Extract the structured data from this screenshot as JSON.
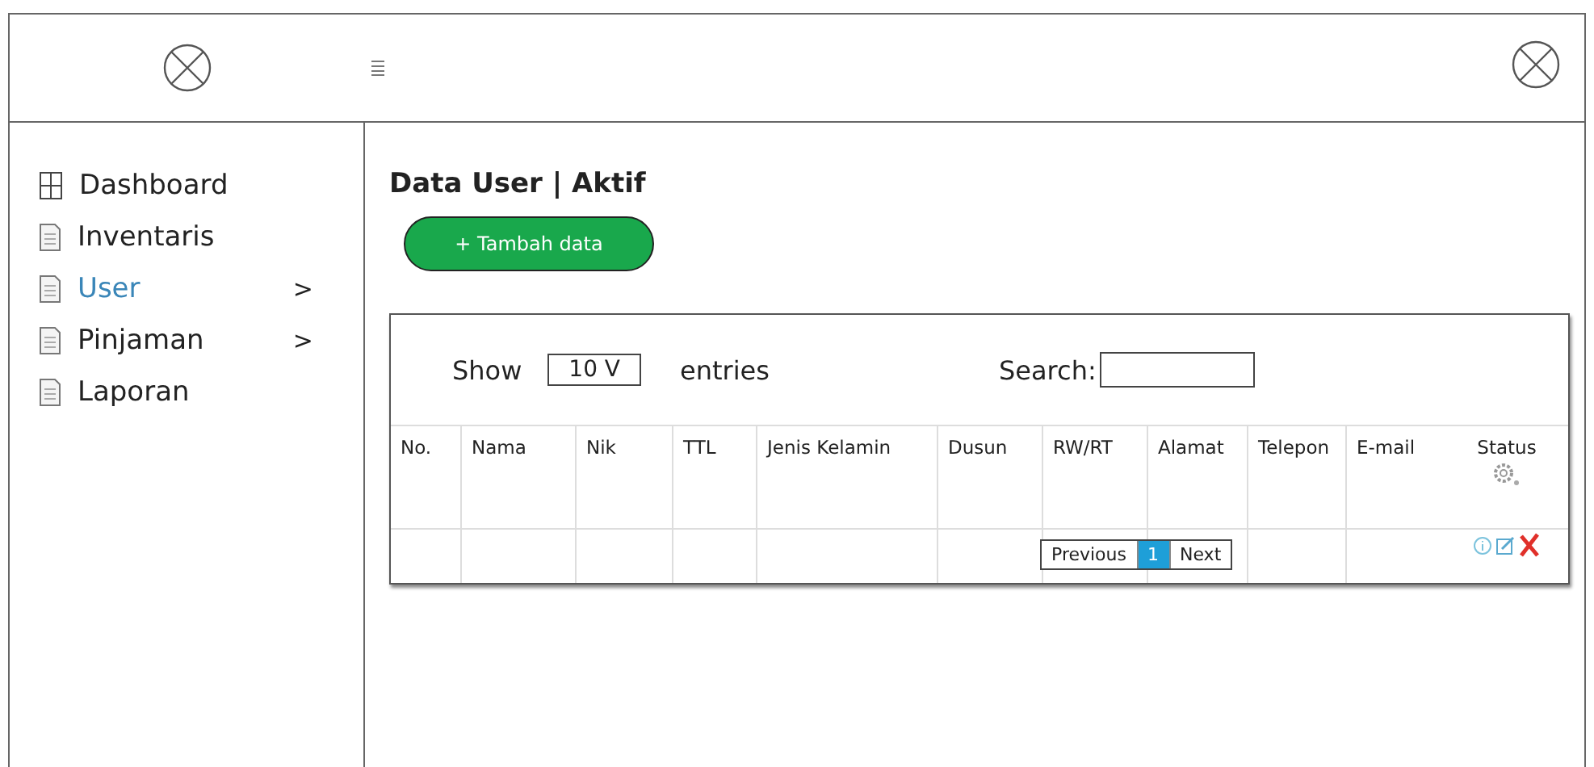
{
  "sidebar": {
    "items": [
      {
        "kind": "grid",
        "label": "Dashboard",
        "selected": false
      },
      {
        "kind": "page",
        "label": "Inventaris",
        "selected": false
      },
      {
        "kind": "page",
        "label": "User",
        "selected": true,
        "arrow": ">"
      },
      {
        "kind": "page",
        "label": "Pinjaman",
        "selected": false,
        "arrow": ">"
      },
      {
        "kind": "page",
        "label": "Laporan",
        "selected": false
      }
    ]
  },
  "page_title": "Data User | Aktif",
  "add_button": "+ Tambah data",
  "table": {
    "show_label": "Show",
    "page_size": "10 V",
    "entries_label": "entries",
    "search_label": "Search:",
    "columns": [
      "No.",
      "Nama",
      "Nik",
      "TTL",
      "Jenis Kelamin",
      "Dusun",
      "RW/RT",
      "Alamat",
      "Telepon",
      "E-mail",
      "Status"
    ],
    "pagination": {
      "previous": "Previous",
      "pages": [
        {
          "label": "1",
          "selected": true
        }
      ],
      "next": "Next"
    }
  }
}
